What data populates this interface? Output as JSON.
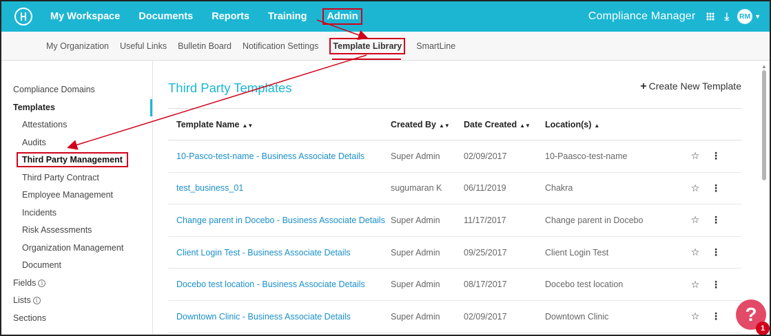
{
  "topnav": {
    "items": [
      "My Workspace",
      "Documents",
      "Reports",
      "Training",
      "Admin"
    ],
    "brand": "Compliance Manager",
    "avatar_initials": "RM",
    "accent_color": "#1cb6d3"
  },
  "subnav": {
    "items": [
      "My Organization",
      "Useful Links",
      "Bulletin Board",
      "Notification Settings",
      "Template Library",
      "SmartLine"
    ]
  },
  "sidebar": {
    "items": [
      {
        "label": "Compliance Domains"
      },
      {
        "label": "Templates"
      },
      {
        "label": "Attestations"
      },
      {
        "label": "Audits"
      },
      {
        "label": "Third Party Management"
      },
      {
        "label": "Third Party Contract"
      },
      {
        "label": "Employee Management"
      },
      {
        "label": "Incidents"
      },
      {
        "label": "Risk Assessments"
      },
      {
        "label": "Organization Management"
      },
      {
        "label": "Document"
      },
      {
        "label": "Fields"
      },
      {
        "label": "Lists"
      },
      {
        "label": "Sections"
      }
    ],
    "info_glyph": "i"
  },
  "main": {
    "title": "Third Party Templates",
    "create_label": "Create New Template",
    "columns": [
      "Template Name",
      "Created By",
      "Date Created",
      "Location(s)"
    ],
    "rows": [
      {
        "name": "10-Pasco-test-name - Business Associate Details",
        "created_by": "Super Admin",
        "date": "02/09/2017",
        "location": "10-Paasco-test-name"
      },
      {
        "name": "test_business_01",
        "created_by": "sugumaran K",
        "date": "06/11/2019",
        "location": "Chakra"
      },
      {
        "name": "Change parent in Docebo - Business Associate Details",
        "created_by": "Super Admin",
        "date": "11/17/2017",
        "location": "Change parent in Docebo"
      },
      {
        "name": "Client Login Test - Business Associate Details",
        "created_by": "Super Admin",
        "date": "09/25/2017",
        "location": "Client Login Test"
      },
      {
        "name": "Docebo test location - Business Associate Details",
        "created_by": "Super Admin",
        "date": "08/17/2017",
        "location": "Docebo test location"
      },
      {
        "name": "Downtown Clinic - Business Associate Details",
        "created_by": "Super Admin",
        "date": "02/09/2017",
        "location": "Downtown Clinic"
      }
    ]
  },
  "help": {
    "label": "?",
    "badge": "1"
  },
  "annotation_color": "#d0021b"
}
